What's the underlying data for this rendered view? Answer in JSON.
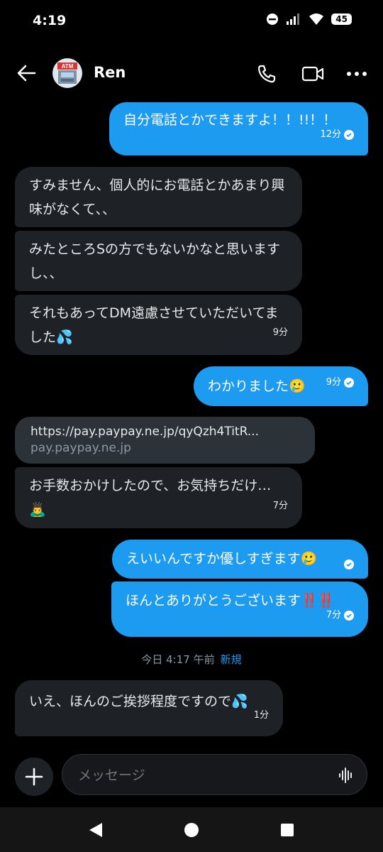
{
  "status": {
    "time": "4:19",
    "battery": "45"
  },
  "header": {
    "name": "Ren",
    "avatar_text": "ATM"
  },
  "messages": [
    {
      "text": "自分電話とかできますよ！！!!！！",
      "time": "12分"
    },
    {
      "text": "すみません、個人的にお電話とかあまり興味がなくて、、"
    },
    {
      "text": "みたところSの方でもないかなと思いますし、、"
    },
    {
      "text": "それもあってDM遠慮させていただいてました💦",
      "time": "9分"
    },
    {
      "text": "わかりました🥲",
      "time": "9分"
    },
    {
      "link_url": "https://pay.paypay.ne.jp/qyQzh4TitR...",
      "link_domain": "pay.paypay.ne.jp"
    },
    {
      "text": "お手数おかけしたので、お気持ちだけ…🙇‍♂️",
      "time": "7分"
    },
    {
      "text": "えいいんですか優しすぎます🥲"
    },
    {
      "text": "ほんとありがとうございます‼️‼️",
      "time": "7分"
    },
    {
      "text": "いえ、ほんのご挨拶程度ですので💦",
      "time": "1分"
    }
  ],
  "date_separator": {
    "text": "今日 4:17 午前",
    "new_label": "新規"
  },
  "composer": {
    "placeholder": "メッセージ"
  },
  "icons": [
    "back-arrow-icon",
    "phone-icon",
    "video-icon",
    "more-icon",
    "plus-icon",
    "voice-icon",
    "nav-back-icon",
    "nav-home-icon",
    "nav-recents-icon"
  ],
  "colors": {
    "outgoing": "#1d9bf0",
    "incoming": "#1e2226",
    "background": "#000000",
    "new_label": "#1d9bf0"
  }
}
